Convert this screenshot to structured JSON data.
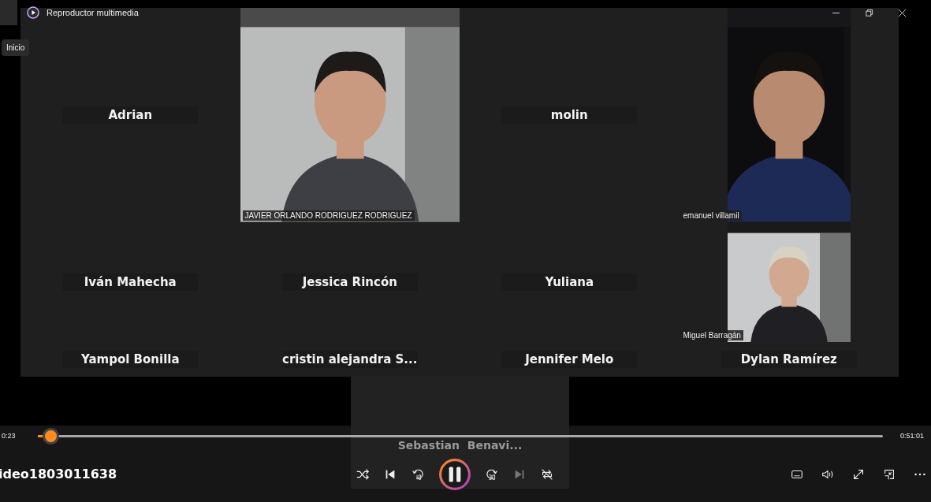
{
  "window": {
    "title": "Reproductor multimedia"
  },
  "tooltip": "Inicio",
  "meeting": {
    "tiles": [
      {
        "kind": "name",
        "name": "Adrian"
      },
      {
        "kind": "video",
        "name": "JAVIER ORLANDO RODRIGUEZ RODRIGUEZ"
      },
      {
        "kind": "name",
        "name": "molin"
      },
      {
        "kind": "portrait",
        "name": "emanuel villamil"
      },
      {
        "kind": "name",
        "name": "Iván Mahecha"
      },
      {
        "kind": "name",
        "name": "Jessica Rincón"
      },
      {
        "kind": "name",
        "name": "Yuliana"
      },
      {
        "kind": "portrait",
        "name": "Miguel Barragán"
      },
      {
        "kind": "name",
        "name": "Yampol Bonilla"
      },
      {
        "kind": "name",
        "name": "cristin alejandra S..."
      },
      {
        "kind": "name",
        "name": "Jennifer Melo"
      },
      {
        "kind": "name",
        "name": "Dylan Ramírez"
      }
    ],
    "floating_tile": {
      "name": "Sebastian  Benavi..."
    }
  },
  "player": {
    "elapsed": "0:23",
    "total": "0:51:01",
    "level": 0.015,
    "file": "ideo1803011638",
    "controls": [
      {
        "kind": "shuffle",
        "disabled": false
      },
      {
        "kind": "previous",
        "disabled": false
      },
      {
        "kind": "back10",
        "disabled": false
      },
      {
        "kind": "pause",
        "disabled": false
      },
      {
        "kind": "forward30",
        "disabled": false
      },
      {
        "kind": "next",
        "disabled": true
      },
      {
        "kind": "repeat",
        "disabled": false
      }
    ],
    "tools": [
      {
        "kind": "subtitles"
      },
      {
        "kind": "volume"
      },
      {
        "kind": "fullscreen"
      },
      {
        "kind": "miniplayer"
      },
      {
        "kind": "more"
      }
    ]
  }
}
